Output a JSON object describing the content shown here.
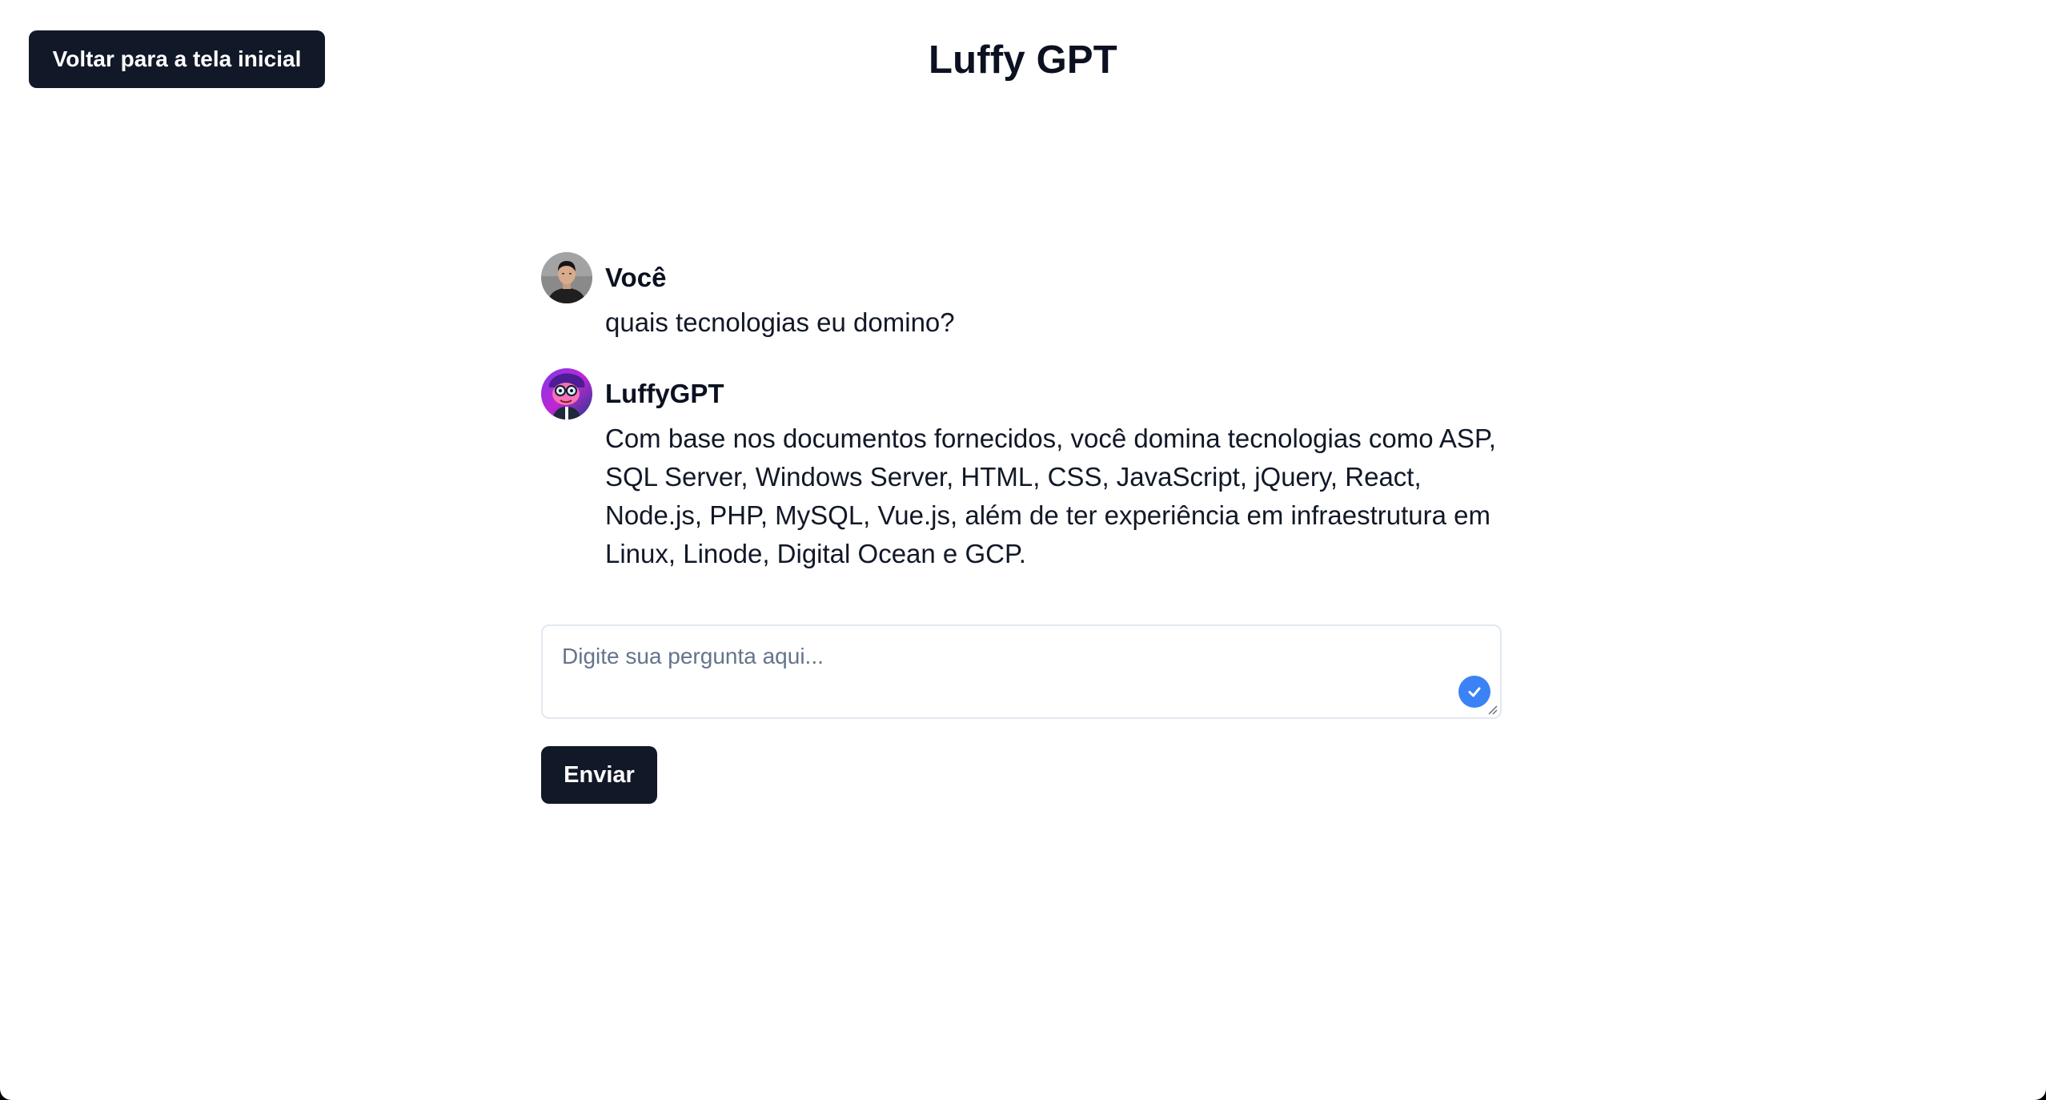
{
  "header": {
    "back_button_label": "Voltar para a tela inicial",
    "title": "Luffy GPT"
  },
  "messages": [
    {
      "sender": "Você",
      "avatar_icon": "user-photo-avatar",
      "text": "quais tecnologias eu domino?"
    },
    {
      "sender": "LuffyGPT",
      "avatar_icon": "luffygpt-bot-avatar",
      "text": "Com base nos documentos fornecidos, você domina tecnologias como ASP, SQL Server, Windows Server, HTML, CSS, JavaScript, jQuery, React, Node.js, PHP, MySQL, Vue.js, além de ter experiência em infraestrutura em Linux, Linode, Digital Ocean e GCP."
    }
  ],
  "input": {
    "placeholder": "Digite sua pergunta aqui...",
    "value": ""
  },
  "send_button_label": "Enviar",
  "colors": {
    "button_bg": "#111827",
    "button_text": "#ffffff",
    "check_badge": "#3b82f6",
    "input_border": "#e2e8f0",
    "placeholder": "#64748b"
  }
}
